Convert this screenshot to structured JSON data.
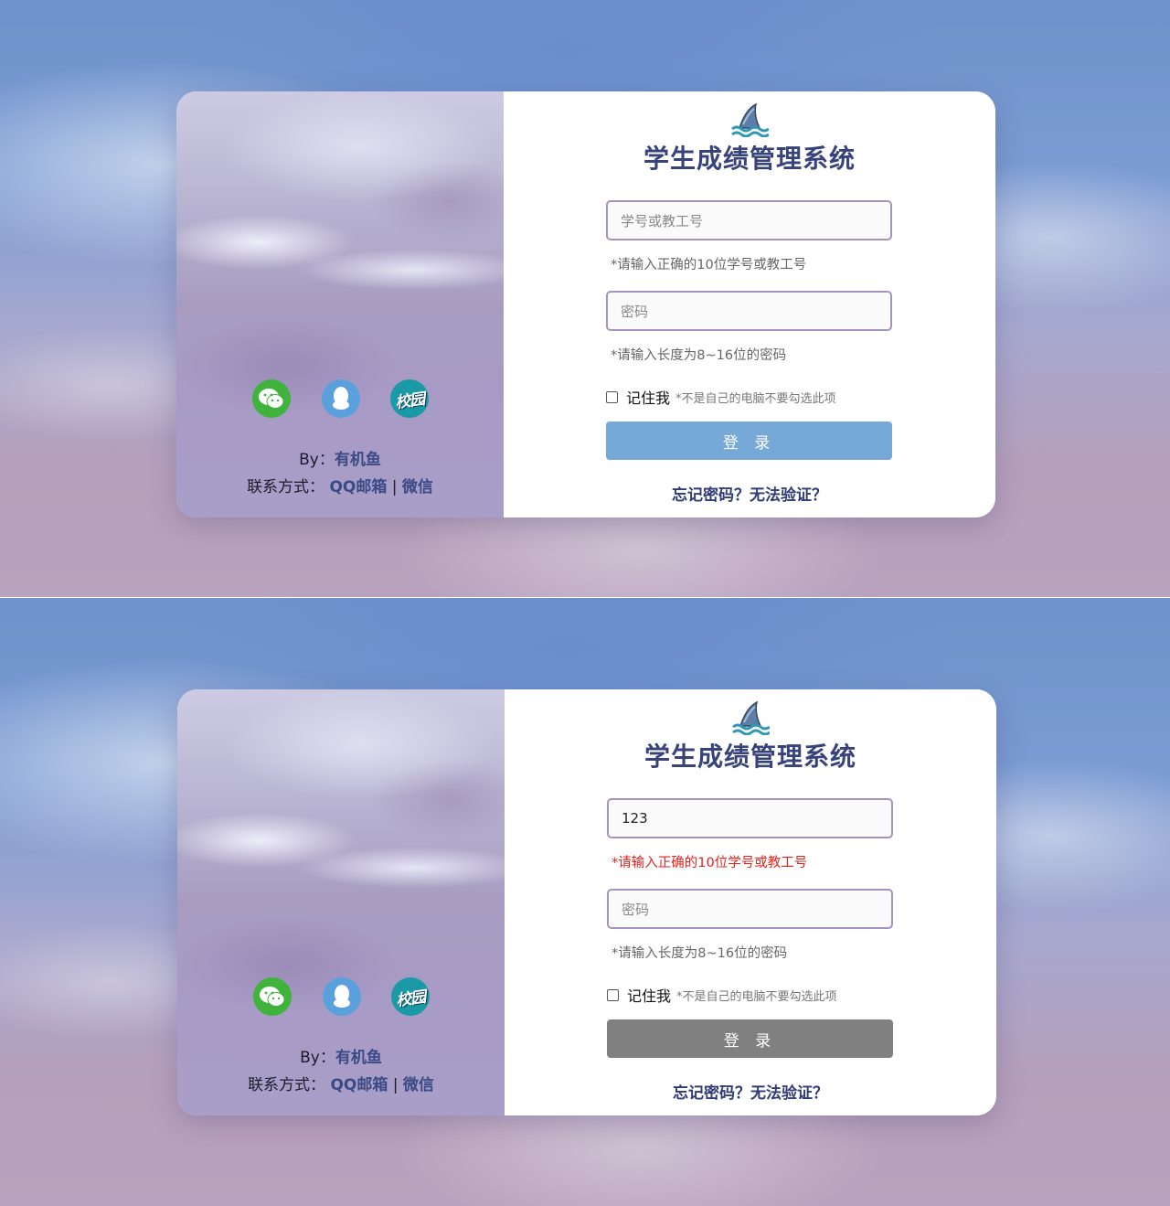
{
  "screens": [
    {
      "title": "学生成绩管理系统",
      "username_value": "",
      "username_placeholder": "学号或教工号",
      "username_hint": "*请输入正确的10位学号或教工号",
      "username_hint_state": "normal",
      "password_placeholder": "密码",
      "password_hint": "*请输入长度为8~16位的密码",
      "remember_label": "记住我",
      "remember_note": "*不是自己的电脑不要勾选此项",
      "remember_checked": false,
      "login_label": "登 录",
      "login_state": "active",
      "forgot_link": "忘记密码？无法验证？",
      "campus_icon_text": "校园",
      "author_prefix": "By：",
      "author_name": "有机鱼",
      "contact_prefix": "联系方式：",
      "contact_email": "QQ邮箱",
      "contact_separator": "|",
      "contact_wechat": "微信"
    },
    {
      "title": "学生成绩管理系统",
      "username_value": "123",
      "username_placeholder": "学号或教工号",
      "username_hint": "*请输入正确的10位学号或教工号",
      "username_hint_state": "error",
      "password_placeholder": "密码",
      "password_hint": "*请输入长度为8~16位的密码",
      "remember_label": "记住我",
      "remember_note": "*不是自己的电脑不要勾选此项",
      "remember_checked": false,
      "login_label": "登 录",
      "login_state": "disabled",
      "forgot_link": "忘记密码？无法验证？",
      "campus_icon_text": "校园",
      "author_prefix": "By：",
      "author_name": "有机鱼",
      "contact_prefix": "联系方式：",
      "contact_email": "QQ邮箱",
      "contact_separator": "|",
      "contact_wechat": "微信"
    }
  ],
  "colors": {
    "title": "#37437a",
    "field_border": "#a593bd",
    "login_active": "#77a9d8",
    "login_disabled": "#808080",
    "error_hint": "#e8221d",
    "wechat": "#3fb33b",
    "qq": "#5aa0dd",
    "campus": "#1a9aa6"
  }
}
